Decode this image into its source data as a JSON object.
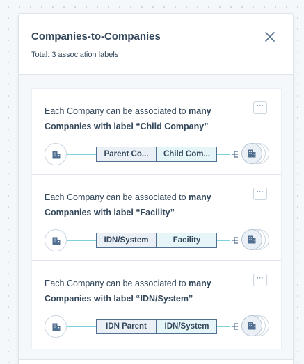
{
  "panel": {
    "title": "Companies-to-Companies",
    "subtitle": "Total: 3 association labels",
    "close_icon": "close-icon"
  },
  "cards": [
    {
      "desc_prefix": "Each Company can be associated to ",
      "desc_bold": "many Companies with label “Child Company”",
      "left_label": "Parent Co...",
      "right_label": "Child Com...",
      "more_label": "⋯"
    },
    {
      "desc_prefix": "Each Company can be associated to ",
      "desc_bold": "many Companies with label “Facility”",
      "left_label": "IDN/System",
      "right_label": "Facility",
      "more_label": "⋯"
    },
    {
      "desc_prefix": "Each Company can be associated to ",
      "desc_bold": "many Companies with label “IDN/System”",
      "left_label": "IDN Parent",
      "right_label": "IDN/System",
      "more_label": "⋯"
    }
  ],
  "icons": {
    "company": "company-building-icon",
    "many_relation": "crow-foot-icon",
    "more": "more-options-icon"
  },
  "colors": {
    "text": "#33475b",
    "link_line": "#7fd1de",
    "label_border": "#516f90",
    "background": "#f5f8fa"
  }
}
